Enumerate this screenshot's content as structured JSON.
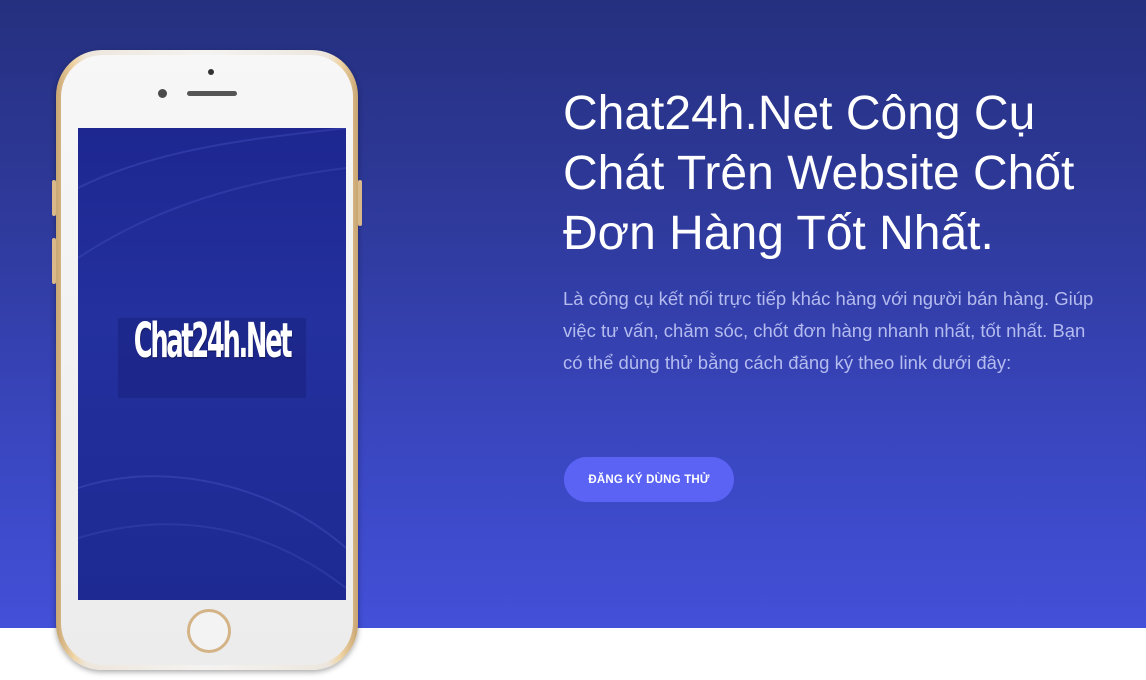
{
  "hero": {
    "headline": "Chat24h.Net Công Cụ Chát Trên Website Chốt Đơn Hàng Tốt Nhất.",
    "description": "Là công cụ kết nối trực tiếp khác hàng với người bán hàng. Giúp việc tư vấn, chăm sóc, chốt đơn hàng nhanh nhất, tốt nhất. Bạn có thể dùng thử bằng cách đăng ký theo link dưới đây:",
    "cta_label": "ĐĂNG KÝ DÙNG THỬ"
  },
  "phone": {
    "screen_logo_text": "Chat24h.Net"
  },
  "colors": {
    "hero_gradient_top": "#25307f",
    "hero_gradient_bottom": "#4350d8",
    "cta_background": "#5b63f5",
    "description_text": "#b3bbef",
    "phone_frame_gold": "#c9a673"
  }
}
